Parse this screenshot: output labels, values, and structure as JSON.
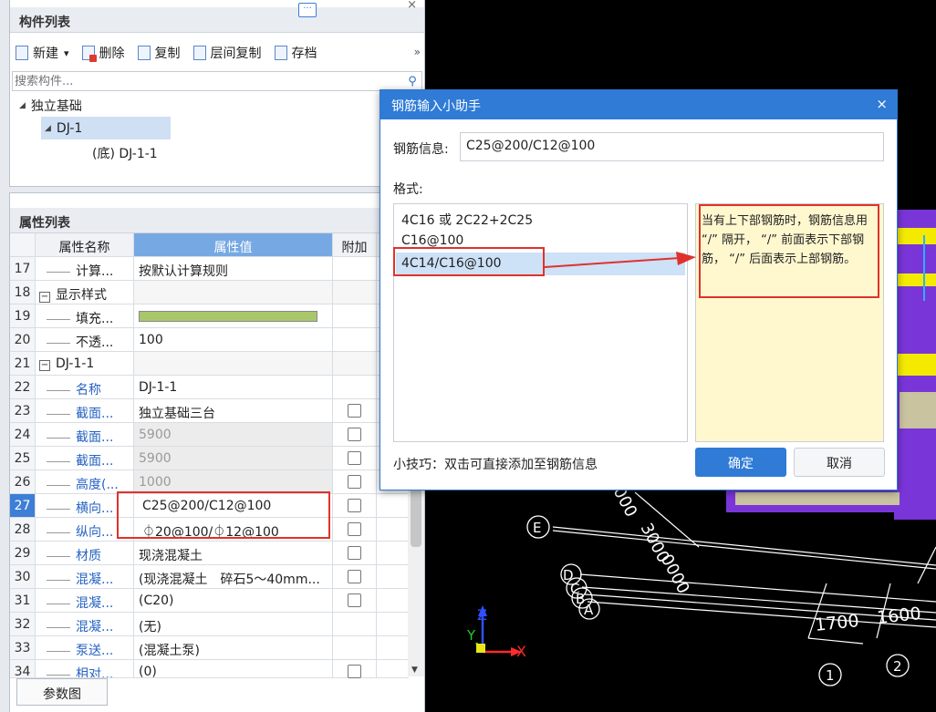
{
  "component_panel": {
    "title": "构件列表",
    "close_icon": "×",
    "toolbar": {
      "new_label": "新建",
      "new_dropdown": "▾",
      "delete_label": "删除",
      "copy_label": "复制",
      "floor_copy_label": "层间复制",
      "archive_label": "存档",
      "more": "»"
    },
    "search_placeholder": "搜索构件...",
    "search_icon": "⚲",
    "tree": {
      "root": "独立基础",
      "child": "DJ-1",
      "grandchild": "(底) DJ-1-1"
    }
  },
  "property_panel": {
    "title": "属性列表",
    "headers": {
      "name": "属性名称",
      "value": "属性值",
      "add": "附加"
    },
    "rows": [
      {
        "num": "17",
        "name": "计算...",
        "value": "按默认计算规则",
        "check": false
      },
      {
        "num": "18",
        "name": "显示样式",
        "value": "",
        "check": false
      },
      {
        "num": "19",
        "name": "填充...",
        "value": "",
        "check": false
      },
      {
        "num": "20",
        "name": "不透...",
        "value": "100",
        "check": false
      },
      {
        "num": "21",
        "name": "DJ-1-1",
        "value": "",
        "check": false
      },
      {
        "num": "22",
        "name": "名称",
        "value": "DJ-1-1",
        "check": false
      },
      {
        "num": "23",
        "name": "截面...",
        "value": "独立基础三台",
        "check": true
      },
      {
        "num": "24",
        "name": "截面...",
        "value": "5900",
        "check": true
      },
      {
        "num": "25",
        "name": "截面...",
        "value": "5900",
        "check": true
      },
      {
        "num": "26",
        "name": "高度(...",
        "value": "1000",
        "check": true
      },
      {
        "num": "27",
        "name": "横向...",
        "value": "C25@200/C12@100",
        "check": true
      },
      {
        "num": "28",
        "name": "纵向...",
        "value": "⏀20@100/⏀12@100",
        "check": true
      },
      {
        "num": "29",
        "name": "材质",
        "value": "现浇混凝土",
        "check": true
      },
      {
        "num": "30",
        "name": "混凝...",
        "value": "(现浇混凝土　碎石5～40mm...",
        "check": true
      },
      {
        "num": "31",
        "name": "混凝...",
        "value": "(C20)",
        "check": true
      },
      {
        "num": "32",
        "name": "混凝...",
        "value": "(无)",
        "check": false
      },
      {
        "num": "33",
        "name": "泵送...",
        "value": "(混凝土泵)",
        "check": false
      },
      {
        "num": "34",
        "name": "相对...",
        "value": "(0)",
        "check": true
      }
    ],
    "ellipsis": "···",
    "param_button": "参数图"
  },
  "dialog": {
    "title": "钢筋输入小助手",
    "close_icon": "×",
    "info_label": "钢筋信息:",
    "info_value": "C25@200/C12@100",
    "format_label": "格式:",
    "formats": [
      "4C16 或 2C22+2C25",
      "C16@100",
      "4C14/C16@100"
    ],
    "hint": "当有上下部钢筋时，钢筋信息用 “/” 隔开， “/” 前面表示下部钢筋， “/” 后面表示上部钢筋。",
    "tip": "小技巧：双击可直接添加至钢筋信息",
    "ok_label": "确定",
    "cancel_label": "取消"
  },
  "viewport": {
    "axis_z": "Z",
    "axis_y": "Y",
    "axis_x": "X",
    "grid_labels": {
      "e": "E",
      "d": "D",
      "c": "C",
      "b": "B",
      "a": "A",
      "one": "1",
      "two": "2"
    },
    "dims": {
      "d1700": "1700",
      "d1600": "1600",
      "d3000": "3000",
      "d000": "000",
      "d0000": "0000"
    }
  },
  "colors": {
    "accent": "#2f7bd6",
    "highlight_red": "#e0322a",
    "hint_bg": "#fff8cf",
    "swatch": "#a9c76a",
    "purple": "#7a35d8",
    "yellow": "#f4ea00"
  }
}
